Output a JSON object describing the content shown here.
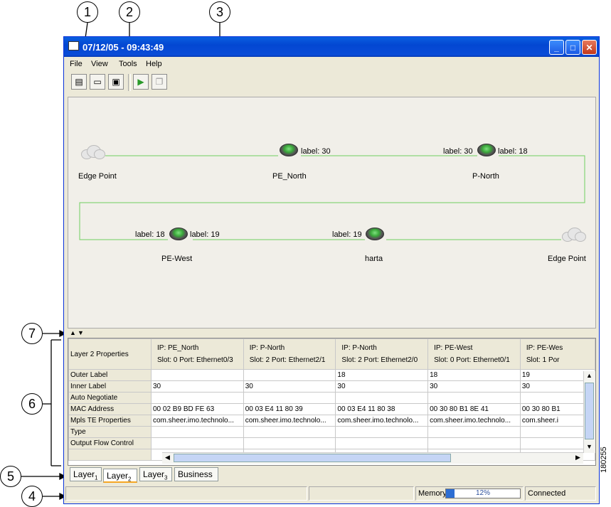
{
  "callouts": [
    "1",
    "2",
    "3",
    "4",
    "5",
    "6",
    "7"
  ],
  "window": {
    "title": "07/12/05 - 09:43:49",
    "app_icon": "computer-icon",
    "min_icon": "minimize-icon",
    "max_icon": "maximize-icon",
    "close_icon": "close-icon"
  },
  "menu": {
    "file": "File",
    "view": "View",
    "tools": "Tools",
    "help": "Help"
  },
  "toolbar": [
    "new-map-icon",
    "monitor-icon",
    "save-icon",
    "run-icon",
    "copy-icon"
  ],
  "topology": {
    "nodes": [
      {
        "name": "Edge Point",
        "type": "cloud"
      },
      {
        "name": "PE_North",
        "type": "router",
        "label_right": "label: 30"
      },
      {
        "name": "P-North",
        "type": "router",
        "label_left": "label: 30",
        "label_right": "label: 18"
      },
      {
        "name": "PE-West",
        "type": "router",
        "label_left": "label: 18",
        "label_right": "label: 19"
      },
      {
        "name": "harta",
        "type": "router",
        "label_left": "label: 19"
      },
      {
        "name": "Edge Point",
        "type": "cloud"
      }
    ],
    "link_color": "#6fcf5f"
  },
  "grid": {
    "corner": "Layer 2 Properties",
    "columns": [
      {
        "ip": "IP:  PE_North",
        "slot": "Slot:  0 Port:  Ethernet0/3"
      },
      {
        "ip": "IP:  P-North",
        "slot": "Slot:  2 Port:  Ethernet2/1"
      },
      {
        "ip": "IP:  P-North",
        "slot": "Slot:  2 Port:  Ethernet2/0"
      },
      {
        "ip": "IP:  PE-West",
        "slot": "Slot:  0 Port:  Ethernet0/1"
      },
      {
        "ip": "IP:  PE-Wes",
        "slot": "Slot:  1 Por"
      }
    ],
    "rows": [
      {
        "name": "Outer Label",
        "cells": [
          "",
          "",
          "18",
          "18",
          "19"
        ]
      },
      {
        "name": "Inner Label",
        "cells": [
          "30",
          "30",
          "30",
          "30",
          "30"
        ]
      },
      {
        "name": "Auto Negotiate",
        "cells": [
          "",
          "",
          "",
          "",
          ""
        ]
      },
      {
        "name": "MAC Address",
        "cells": [
          "00 02 B9 BD FE 63",
          "00 03 E4 11 80 39",
          "00 03 E4 11 80 38",
          "00 30 80 B1 8E 41",
          "00 30 80 B1"
        ]
      },
      {
        "name": "Mpls TE Properties",
        "cells": [
          "com.sheer.imo.technolo...",
          "com.sheer.imo.technolo...",
          "com.sheer.imo.technolo...",
          "com.sheer.imo.technolo...",
          "com.sheer.i"
        ]
      },
      {
        "name": "Type",
        "cells": [
          "",
          "",
          "",
          "",
          ""
        ]
      },
      {
        "name": "Output Flow Control",
        "cells": [
          "",
          "",
          "",
          "",
          ""
        ]
      }
    ]
  },
  "tabs": [
    {
      "label": "Layer",
      "sub": "1"
    },
    {
      "label": "Layer",
      "sub": "2"
    },
    {
      "label": "Layer",
      "sub": "3"
    },
    {
      "label": "Business",
      "sub": ""
    }
  ],
  "status": {
    "memory_label": "Memory:",
    "memory_text": "12%",
    "memory_fraction": 0.12,
    "connection": "Connected"
  },
  "figure_number": "180255"
}
